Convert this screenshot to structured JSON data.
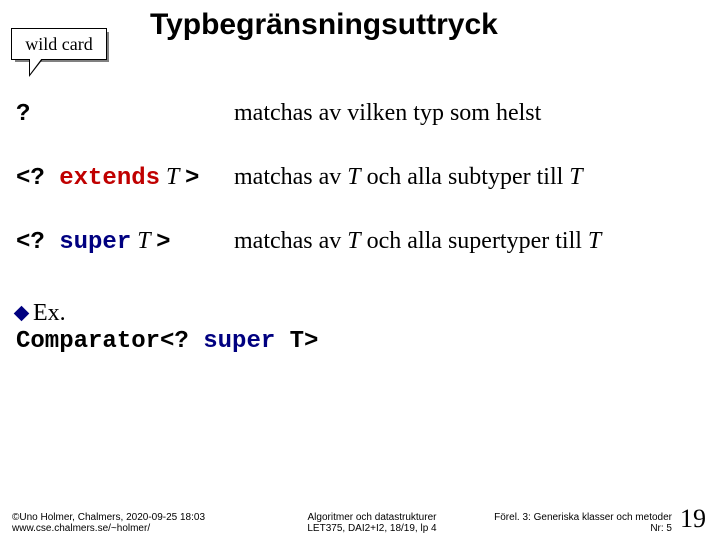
{
  "callout": {
    "label": "wild card"
  },
  "title": "Typbegränsningsuttryck",
  "rows": [
    {
      "lhs_pre": "?",
      "lhs_kw": "",
      "lhs_kw_class": "",
      "lhs_T": "",
      "lhs_post": "",
      "rhs_pre": "matchas av vilken typ som helst",
      "rhs_T1": "",
      "rhs_mid": "",
      "rhs_T2": ""
    },
    {
      "lhs_pre": "<? ",
      "lhs_kw": "extends",
      "lhs_kw_class": "kw-extends",
      "lhs_T": " T ",
      "lhs_post": ">",
      "rhs_pre": "matchas av ",
      "rhs_T1": "T",
      "rhs_mid": " och alla subtyper till ",
      "rhs_T2": "T"
    },
    {
      "lhs_pre": "<? ",
      "lhs_kw": "super",
      "lhs_kw_class": "kw-super",
      "lhs_T": " T ",
      "lhs_post": ">",
      "rhs_pre": "matchas av ",
      "rhs_T1": "T",
      "rhs_mid": " och alla supertyper till ",
      "rhs_T2": "T"
    }
  ],
  "example": {
    "lead": "Ex.",
    "line_pre": "Comparator<? ",
    "line_kw": "super",
    "line_post": " T>"
  },
  "footer": {
    "left": "©Uno Holmer, Chalmers, 2020-09-25 18:03\nwww.cse.chalmers.se/~holmer/",
    "center": "Algoritmer och datastrukturer\nLET375, DAI2+I2, 18/19, lp 4",
    "right": "Förel. 3: Generiska klasser och metoder\nNr: 5",
    "page": "19"
  }
}
